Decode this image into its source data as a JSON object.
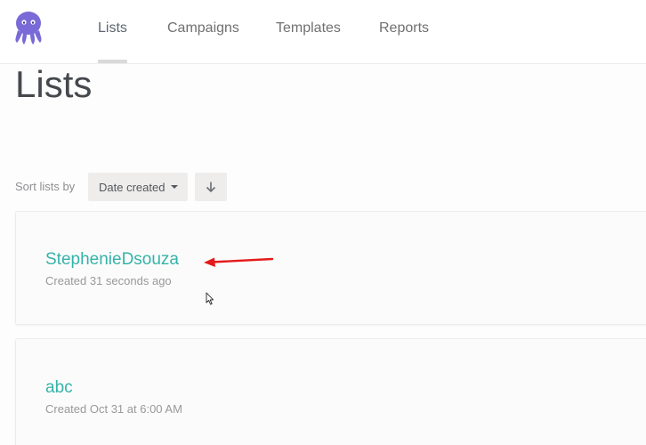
{
  "nav": {
    "logo_icon": "octopus-logo-icon",
    "items": [
      {
        "label": "Lists",
        "active": true
      },
      {
        "label": "Campaigns",
        "active": false
      },
      {
        "label": "Templates",
        "active": false
      },
      {
        "label": "Reports",
        "active": false
      }
    ]
  },
  "page": {
    "title": "Lists"
  },
  "sort": {
    "label": "Sort lists by",
    "selected": "Date created",
    "direction_icon": "arrow-down-icon"
  },
  "lists": [
    {
      "name": "StephenieDsouza",
      "meta": "Created 31 seconds ago"
    },
    {
      "name": "abc",
      "meta": "Created Oct 31 at 6:00 AM"
    }
  ],
  "colors": {
    "accent": "#35b3a9",
    "logo": "#7a6ad8",
    "annotation": "#e31b1b"
  }
}
